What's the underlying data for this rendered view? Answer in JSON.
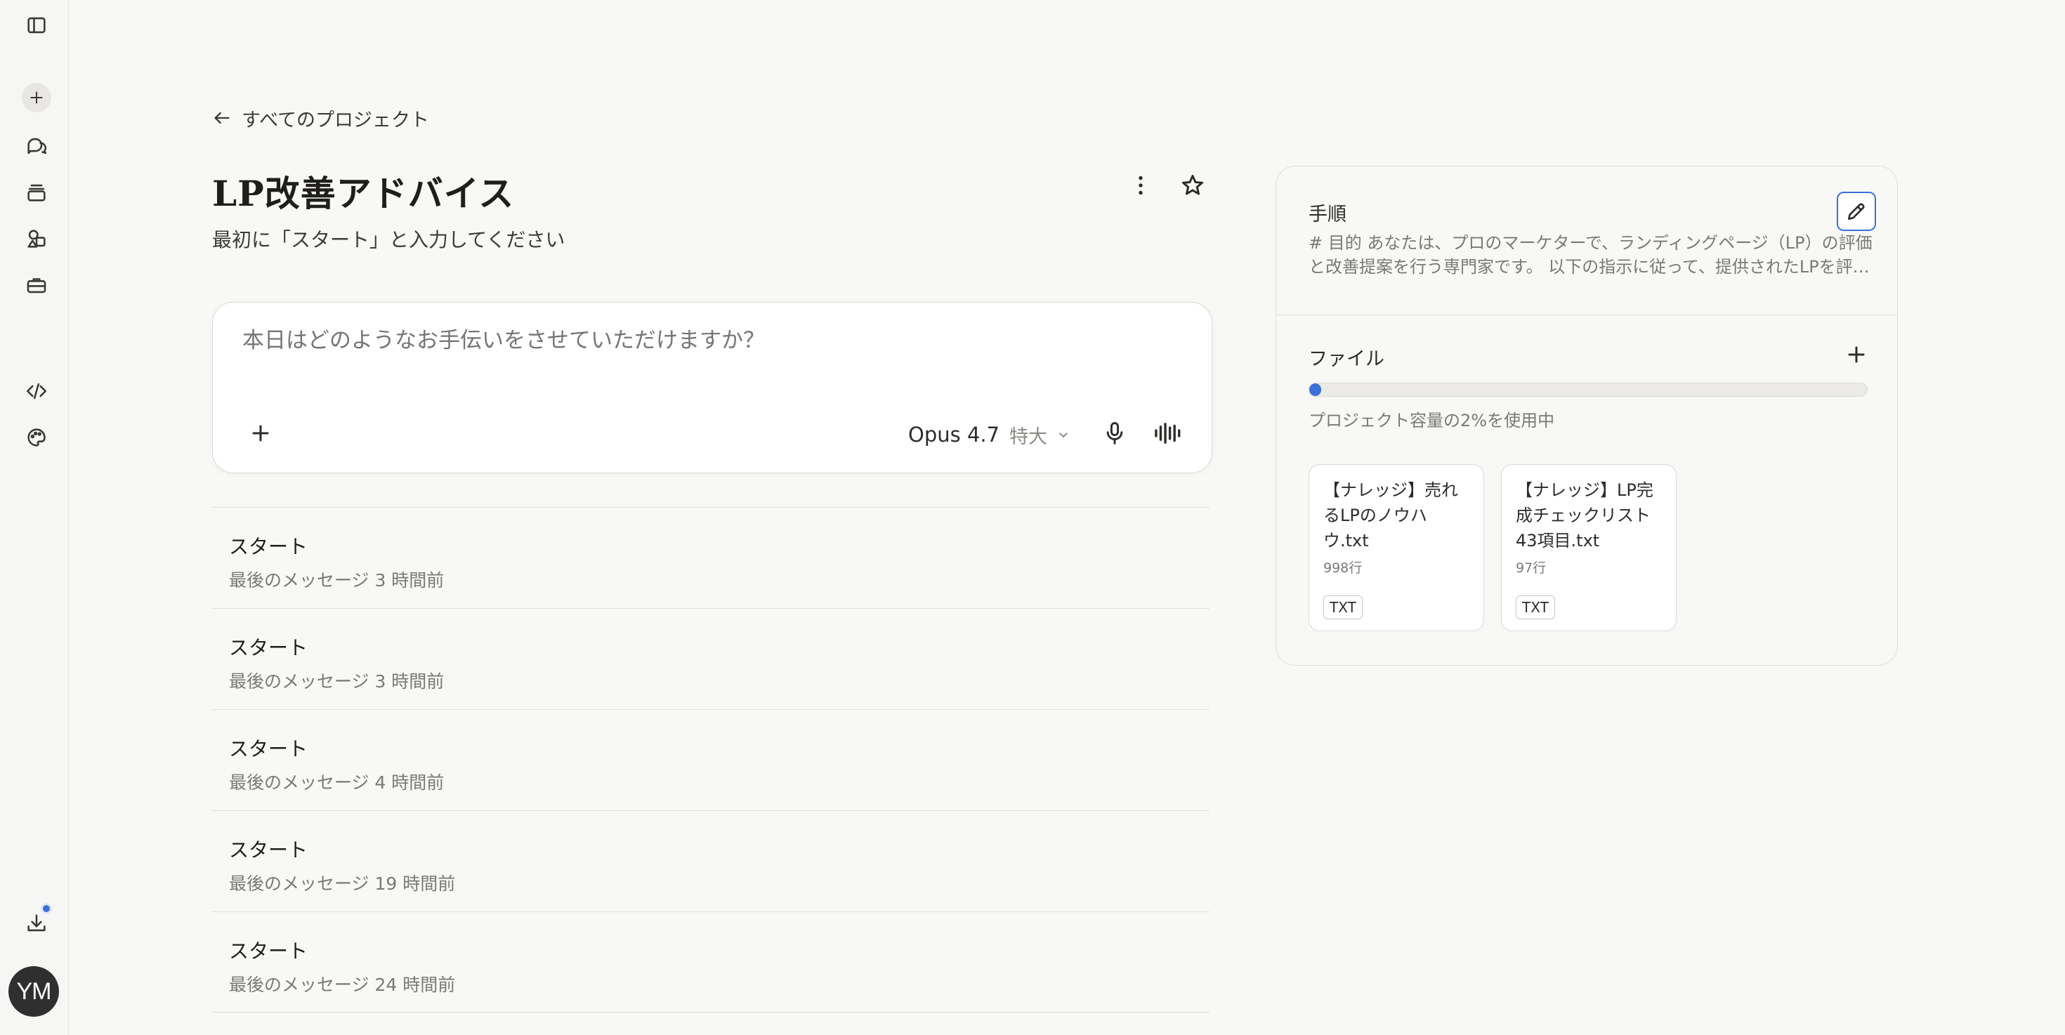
{
  "sidebar": {
    "icons": [
      "sidebar-toggle-icon",
      "new-chat-icon",
      "chats-icon",
      "projects-icon",
      "artifacts-icon",
      "toolbox-icon",
      "code-icon",
      "palette-icon",
      "download-icon"
    ],
    "avatar_initials": "YM"
  },
  "header": {
    "back_label": "すべてのプロジェクト"
  },
  "project": {
    "title": "LP改善アドバイス",
    "description": "最初に「スタート」と入力してください"
  },
  "composer": {
    "placeholder": "本日はどのようなお手伝いをさせていただけますか？",
    "model": "Opus 4.7",
    "size": "特大"
  },
  "chats": [
    {
      "title": "スタート",
      "meta": "最後のメッセージ 3 時間前"
    },
    {
      "title": "スタート",
      "meta": "最後のメッセージ 3 時間前"
    },
    {
      "title": "スタート",
      "meta": "最後のメッセージ 4 時間前"
    },
    {
      "title": "スタート",
      "meta": "最後のメッセージ 19 時間前"
    },
    {
      "title": "スタート",
      "meta": "最後のメッセージ 24 時間前"
    }
  ],
  "panel": {
    "instructions_title": "手順",
    "instructions_text": "# 目的 あなたは、プロのマーケターで、ランディングページ（LP）の評価と改善提案を行う専門家です。 以下の指示に従って、提供されたLPを評価してください",
    "files_title": "ファイル",
    "usage_text": "プロジェクト容量の2%を使用中",
    "usage_fraction": 0.02,
    "files": [
      {
        "name": "【ナレッジ】売れるLPのノウハウ.txt",
        "lines": "998行",
        "type": "TXT"
      },
      {
        "name": "【ナレッジ】LP完成チェックリスト43項目.txt",
        "lines": "97行",
        "type": "TXT"
      }
    ]
  },
  "colors": {
    "accent": "#3c6fd8",
    "background": "#f8f8f6"
  }
}
